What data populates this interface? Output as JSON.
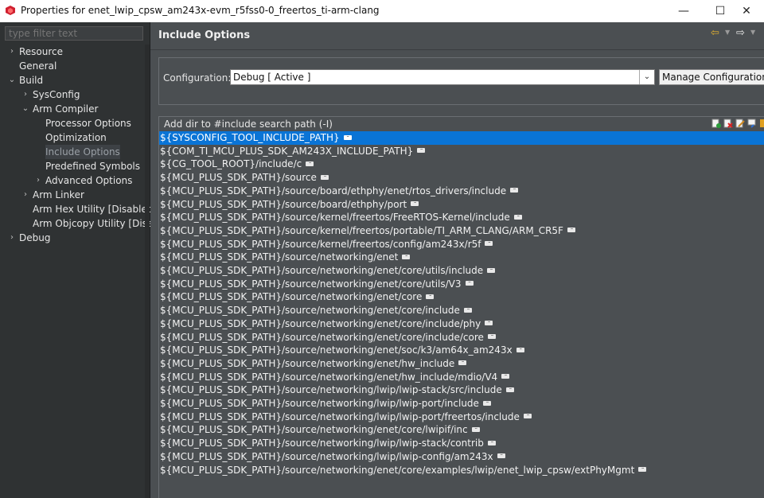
{
  "window": {
    "title": "Properties for enet_lwip_cpsw_am243x-evm_r5fss0-0_freertos_ti-arm-clang",
    "minimize": "—",
    "maximize": "☐",
    "close": "✕"
  },
  "sidebar": {
    "filter_placeholder": "type filter text",
    "items": [
      {
        "label": "Resource",
        "chev": "›"
      },
      {
        "label": "General",
        "chev": ""
      },
      {
        "label": "Build",
        "chev": "⌄"
      },
      {
        "label": "SysConfig",
        "chev": "›"
      },
      {
        "label": "Arm Compiler",
        "chev": "⌄"
      },
      {
        "label": "Processor Options",
        "chev": ""
      },
      {
        "label": "Optimization",
        "chev": ""
      },
      {
        "label": "Include Options",
        "chev": ""
      },
      {
        "label": "Predefined Symbols",
        "chev": ""
      },
      {
        "label": "Advanced Options",
        "chev": "›"
      },
      {
        "label": "Arm Linker",
        "chev": "›"
      },
      {
        "label": "Arm Hex Utility  [Disabled]",
        "chev": ""
      },
      {
        "label": "Arm Objcopy Utility  [Disal",
        "chev": ""
      },
      {
        "label": "Debug",
        "chev": "›"
      }
    ]
  },
  "header": {
    "title": "Include Options",
    "back_icon": "⇦",
    "forward_icon": "⇨",
    "dropdown_icon": "▼"
  },
  "config": {
    "label": "Configuration:",
    "selected": "Debug  [ Active ]",
    "arrow": "⌄",
    "manage_label": "Manage Configurations..."
  },
  "include_list": {
    "header": "Add dir to #include search path (-I)",
    "dots": "···",
    "paths": [
      "${SYSCONFIG_TOOL_INCLUDE_PATH}",
      "${COM_TI_MCU_PLUS_SDK_AM243X_INCLUDE_PATH}",
      "${CG_TOOL_ROOT}/include/c",
      "${MCU_PLUS_SDK_PATH}/source",
      "${MCU_PLUS_SDK_PATH}/source/board/ethphy/enet/rtos_drivers/include",
      "${MCU_PLUS_SDK_PATH}/source/board/ethphy/port",
      "${MCU_PLUS_SDK_PATH}/source/kernel/freertos/FreeRTOS-Kernel/include",
      "${MCU_PLUS_SDK_PATH}/source/kernel/freertos/portable/TI_ARM_CLANG/ARM_CR5F",
      "${MCU_PLUS_SDK_PATH}/source/kernel/freertos/config/am243x/r5f",
      "${MCU_PLUS_SDK_PATH}/source/networking/enet",
      "${MCU_PLUS_SDK_PATH}/source/networking/enet/core/utils/include",
      "${MCU_PLUS_SDK_PATH}/source/networking/enet/core/utils/V3",
      "${MCU_PLUS_SDK_PATH}/source/networking/enet/core",
      "${MCU_PLUS_SDK_PATH}/source/networking/enet/core/include",
      "${MCU_PLUS_SDK_PATH}/source/networking/enet/core/include/phy",
      "${MCU_PLUS_SDK_PATH}/source/networking/enet/core/include/core",
      "${MCU_PLUS_SDK_PATH}/source/networking/enet/soc/k3/am64x_am243x",
      "${MCU_PLUS_SDK_PATH}/source/networking/enet/hw_include",
      "${MCU_PLUS_SDK_PATH}/source/networking/enet/hw_include/mdio/V4",
      "${MCU_PLUS_SDK_PATH}/source/networking/lwip/lwip-stack/src/include",
      "${MCU_PLUS_SDK_PATH}/source/networking/lwip/lwip-port/include",
      "${MCU_PLUS_SDK_PATH}/source/networking/lwip/lwip-port/freertos/include",
      "${MCU_PLUS_SDK_PATH}/source/networking/enet/core/lwipif/inc",
      "${MCU_PLUS_SDK_PATH}/source/networking/lwip/lwip-stack/contrib",
      "${MCU_PLUS_SDK_PATH}/source/networking/lwip/lwip-config/am243x",
      "${MCU_PLUS_SDK_PATH}/source/networking/enet/core/examples/lwip/enet_lwip_cpsw/extPhyMgmt"
    ]
  },
  "colors": {
    "selection": "#0a74d6",
    "panel_bg": "#4b4f52",
    "sidebar_bg": "#2f3233"
  }
}
